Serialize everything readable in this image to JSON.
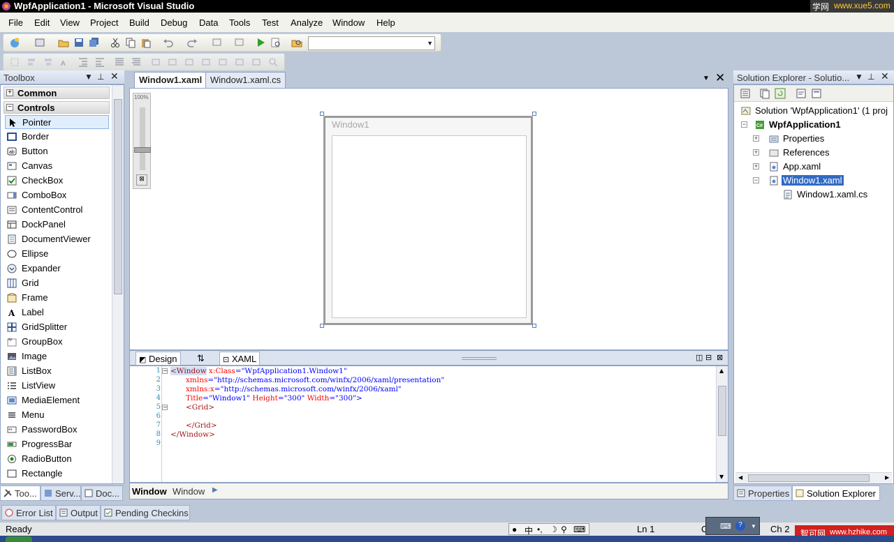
{
  "window": {
    "title": "WpfApplication1 - Microsoft Visual Studio"
  },
  "watermark_top": {
    "text_a": "学网",
    "text_b": "www.xue5.com"
  },
  "menu": [
    "File",
    "Edit",
    "View",
    "Project",
    "Build",
    "Debug",
    "Data",
    "Tools",
    "Test",
    "Analyze",
    "Window",
    "Help"
  ],
  "toolbox": {
    "title": "Toolbox",
    "groups": {
      "common": "Common",
      "controls": "Controls"
    },
    "items": [
      "Pointer",
      "Border",
      "Button",
      "Canvas",
      "CheckBox",
      "ComboBox",
      "ContentControl",
      "DockPanel",
      "DocumentViewer",
      "Ellipse",
      "Expander",
      "Grid",
      "Frame",
      "Label",
      "GridSplitter",
      "GroupBox",
      "Image",
      "ListBox",
      "ListView",
      "MediaElement",
      "Menu",
      "PasswordBox",
      "ProgressBar",
      "RadioButton",
      "Rectangle"
    ],
    "bottom_tabs": [
      "Too...",
      "Serv...",
      "Doc..."
    ]
  },
  "editor": {
    "tabs": [
      "Window1.xaml",
      "Window1.xaml.cs"
    ],
    "designer_zoom": "100%",
    "wpf_window_title": "Window1",
    "split_tabs": {
      "design": "Design",
      "swap": "⇅",
      "xaml": "XAML"
    },
    "line_numbers": [
      "1",
      "2",
      "3",
      "4",
      "5",
      "6",
      "7",
      "8",
      "9"
    ],
    "code": {
      "l1_tag": "<Window",
      "l1_attr": "x:Class",
      "l1_val": "=\"WpfApplication1.Window1\"",
      "l2_attr": "xmlns",
      "l2_val": "=\"http://schemas.microsoft.com/winfx/2006/xaml/presentation\"",
      "l3_attr": "xmlns:x",
      "l3_val": "=\"http://schemas.microsoft.com/winfx/2006/xaml\"",
      "l4_attr1": "Title",
      "l4_val1": "=\"Window1\"",
      "l4_attr2": "Height",
      "l4_val2": "=\"300\"",
      "l4_attr3": "Width",
      "l4_val3": "=\"300\">",
      "l5": "<Grid>",
      "l7": "</Grid>",
      "l8": "</Window>"
    },
    "breadcrumb": {
      "bold": "Window",
      "normal": "Window"
    }
  },
  "solution_explorer": {
    "title": "Solution Explorer - Solutio...",
    "solution": "Solution 'WpfApplication1' (1 proj",
    "project": "WpfApplication1",
    "items": [
      "Properties",
      "References",
      "App.xaml",
      "Window1.xaml",
      "Window1.xaml.cs"
    ],
    "bottom_tabs": [
      "Properties",
      "Solution Explorer"
    ]
  },
  "output_tabs": [
    "Error List",
    "Output",
    "Pending Checkins"
  ],
  "status": {
    "ready": "Ready",
    "ln": "Ln 1",
    "col": "C",
    "ch": "Ch 2",
    "ime": "中"
  },
  "watermark_bottom": {
    "text_a": "智可网",
    "text_b": "www.hzhike.com"
  },
  "colors": {
    "accent": "#316ac5",
    "panel_border": "#8ea2c4",
    "background": "#bcc7d8"
  }
}
